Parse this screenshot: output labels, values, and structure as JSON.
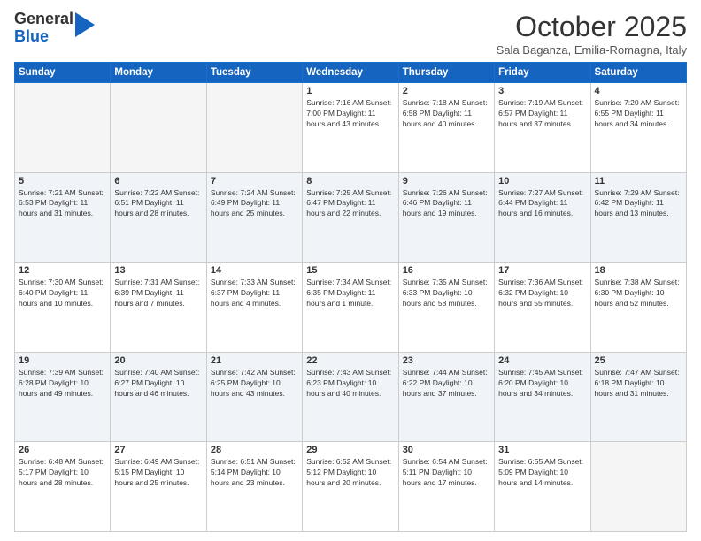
{
  "logo": {
    "general": "General",
    "blue": "Blue"
  },
  "header": {
    "month": "October 2025",
    "location": "Sala Baganza, Emilia-Romagna, Italy"
  },
  "weekdays": [
    "Sunday",
    "Monday",
    "Tuesday",
    "Wednesday",
    "Thursday",
    "Friday",
    "Saturday"
  ],
  "weeks": [
    [
      {
        "day": "",
        "info": ""
      },
      {
        "day": "",
        "info": ""
      },
      {
        "day": "",
        "info": ""
      },
      {
        "day": "1",
        "info": "Sunrise: 7:16 AM\nSunset: 7:00 PM\nDaylight: 11 hours\nand 43 minutes."
      },
      {
        "day": "2",
        "info": "Sunrise: 7:18 AM\nSunset: 6:58 PM\nDaylight: 11 hours\nand 40 minutes."
      },
      {
        "day": "3",
        "info": "Sunrise: 7:19 AM\nSunset: 6:57 PM\nDaylight: 11 hours\nand 37 minutes."
      },
      {
        "day": "4",
        "info": "Sunrise: 7:20 AM\nSunset: 6:55 PM\nDaylight: 11 hours\nand 34 minutes."
      }
    ],
    [
      {
        "day": "5",
        "info": "Sunrise: 7:21 AM\nSunset: 6:53 PM\nDaylight: 11 hours\nand 31 minutes."
      },
      {
        "day": "6",
        "info": "Sunrise: 7:22 AM\nSunset: 6:51 PM\nDaylight: 11 hours\nand 28 minutes."
      },
      {
        "day": "7",
        "info": "Sunrise: 7:24 AM\nSunset: 6:49 PM\nDaylight: 11 hours\nand 25 minutes."
      },
      {
        "day": "8",
        "info": "Sunrise: 7:25 AM\nSunset: 6:47 PM\nDaylight: 11 hours\nand 22 minutes."
      },
      {
        "day": "9",
        "info": "Sunrise: 7:26 AM\nSunset: 6:46 PM\nDaylight: 11 hours\nand 19 minutes."
      },
      {
        "day": "10",
        "info": "Sunrise: 7:27 AM\nSunset: 6:44 PM\nDaylight: 11 hours\nand 16 minutes."
      },
      {
        "day": "11",
        "info": "Sunrise: 7:29 AM\nSunset: 6:42 PM\nDaylight: 11 hours\nand 13 minutes."
      }
    ],
    [
      {
        "day": "12",
        "info": "Sunrise: 7:30 AM\nSunset: 6:40 PM\nDaylight: 11 hours\nand 10 minutes."
      },
      {
        "day": "13",
        "info": "Sunrise: 7:31 AM\nSunset: 6:39 PM\nDaylight: 11 hours\nand 7 minutes."
      },
      {
        "day": "14",
        "info": "Sunrise: 7:33 AM\nSunset: 6:37 PM\nDaylight: 11 hours\nand 4 minutes."
      },
      {
        "day": "15",
        "info": "Sunrise: 7:34 AM\nSunset: 6:35 PM\nDaylight: 11 hours\nand 1 minute."
      },
      {
        "day": "16",
        "info": "Sunrise: 7:35 AM\nSunset: 6:33 PM\nDaylight: 10 hours\nand 58 minutes."
      },
      {
        "day": "17",
        "info": "Sunrise: 7:36 AM\nSunset: 6:32 PM\nDaylight: 10 hours\nand 55 minutes."
      },
      {
        "day": "18",
        "info": "Sunrise: 7:38 AM\nSunset: 6:30 PM\nDaylight: 10 hours\nand 52 minutes."
      }
    ],
    [
      {
        "day": "19",
        "info": "Sunrise: 7:39 AM\nSunset: 6:28 PM\nDaylight: 10 hours\nand 49 minutes."
      },
      {
        "day": "20",
        "info": "Sunrise: 7:40 AM\nSunset: 6:27 PM\nDaylight: 10 hours\nand 46 minutes."
      },
      {
        "day": "21",
        "info": "Sunrise: 7:42 AM\nSunset: 6:25 PM\nDaylight: 10 hours\nand 43 minutes."
      },
      {
        "day": "22",
        "info": "Sunrise: 7:43 AM\nSunset: 6:23 PM\nDaylight: 10 hours\nand 40 minutes."
      },
      {
        "day": "23",
        "info": "Sunrise: 7:44 AM\nSunset: 6:22 PM\nDaylight: 10 hours\nand 37 minutes."
      },
      {
        "day": "24",
        "info": "Sunrise: 7:45 AM\nSunset: 6:20 PM\nDaylight: 10 hours\nand 34 minutes."
      },
      {
        "day": "25",
        "info": "Sunrise: 7:47 AM\nSunset: 6:18 PM\nDaylight: 10 hours\nand 31 minutes."
      }
    ],
    [
      {
        "day": "26",
        "info": "Sunrise: 6:48 AM\nSunset: 5:17 PM\nDaylight: 10 hours\nand 28 minutes."
      },
      {
        "day": "27",
        "info": "Sunrise: 6:49 AM\nSunset: 5:15 PM\nDaylight: 10 hours\nand 25 minutes."
      },
      {
        "day": "28",
        "info": "Sunrise: 6:51 AM\nSunset: 5:14 PM\nDaylight: 10 hours\nand 23 minutes."
      },
      {
        "day": "29",
        "info": "Sunrise: 6:52 AM\nSunset: 5:12 PM\nDaylight: 10 hours\nand 20 minutes."
      },
      {
        "day": "30",
        "info": "Sunrise: 6:54 AM\nSunset: 5:11 PM\nDaylight: 10 hours\nand 17 minutes."
      },
      {
        "day": "31",
        "info": "Sunrise: 6:55 AM\nSunset: 5:09 PM\nDaylight: 10 hours\nand 14 minutes."
      },
      {
        "day": "",
        "info": ""
      }
    ]
  ]
}
